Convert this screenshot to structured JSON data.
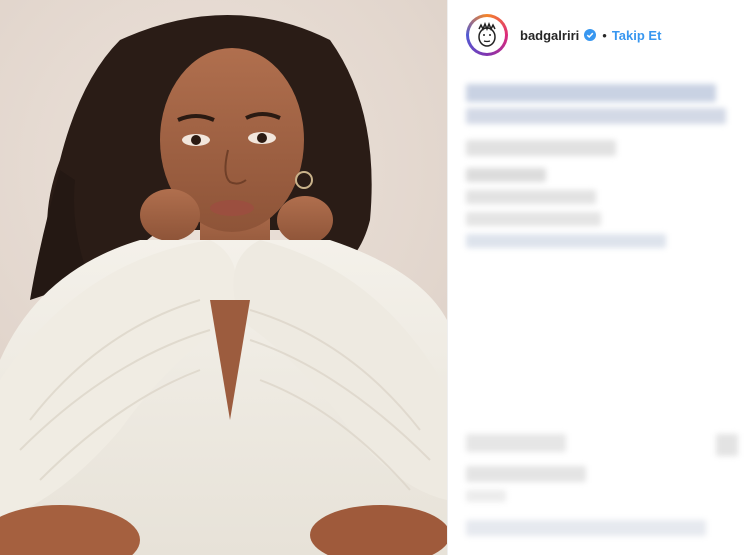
{
  "post": {
    "author": {
      "username": "badgalriri",
      "verified": true,
      "separator": "•",
      "follow_label": "Takip Et"
    },
    "avatar_icon": "cartoon-face-icon",
    "verified_icon": "verified-badge-icon",
    "colors": {
      "follow_blue": "#3897f0",
      "text": "#262626",
      "verified_blue": "#3897f0",
      "panel_border": "#efefef"
    }
  }
}
